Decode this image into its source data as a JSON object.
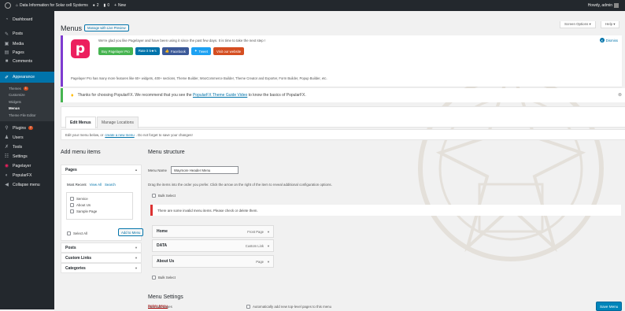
{
  "adminbar": {
    "site_name": "Data Information for Solar cell Systems",
    "comments_count": "2",
    "updates_count": "0",
    "new_label": "New",
    "howdy": "Howdy, admin"
  },
  "sidebar": {
    "items": [
      {
        "label": "Dashboard",
        "icon": "dashboard-icon"
      },
      {
        "label": "Posts",
        "icon": "pin-icon"
      },
      {
        "label": "Media",
        "icon": "media-icon"
      },
      {
        "label": "Pages",
        "icon": "page-icon"
      },
      {
        "label": "Comments",
        "icon": "comment-icon"
      },
      {
        "label": "Appearance",
        "icon": "brush-icon"
      }
    ],
    "appearance_sub": [
      "Themes",
      "Customize",
      "Widgets",
      "Menus",
      "Theme File Editor"
    ],
    "themes_badge": "1",
    "items_after": [
      {
        "label": "Plugins",
        "icon": "plugin-icon",
        "badge": "2"
      },
      {
        "label": "Users",
        "icon": "users-icon"
      },
      {
        "label": "Tools",
        "icon": "tools-icon"
      },
      {
        "label": "Settings",
        "icon": "settings-icon"
      },
      {
        "label": "PopularFX",
        "icon": "popularfx-icon"
      },
      {
        "label": "Pagelayer",
        "icon": "pagelayer-icon"
      }
    ],
    "collapse_label": "Collapse menu"
  },
  "header": {
    "title": "Menus",
    "manage_live": "Manage with Live Preview",
    "screen_options": "Screen Options ▾",
    "help": "Help ▾"
  },
  "pf_notice": {
    "text": "We're glad you like Pagelayer and have been using it since the past few days. It is time to take the next step !",
    "buttons": [
      "Buy Pagelayer Pro",
      "Rate it 5★'s",
      "Facebook",
      "Tweet",
      "Visit our website"
    ],
    "features": "Pagelayer Pro has many more features like 60+ widgets, 400+ sections, Theme Builder, WooCommerce Builder, Theme Creator and Exporter, Form Builder, Popup Builder, etc.",
    "dismiss": "Dismiss",
    "logo_letter": "p"
  },
  "thanks_notice": {
    "text_before": "Thanks for choosing PopularFX. We recommend that you see the ",
    "link": "PopularFX Theme Guide Video",
    "text_after": " to know the basics of PopularFX."
  },
  "tabs": [
    "Edit Menus",
    "Manage Locations"
  ],
  "edit_note": {
    "before": "Edit your menu below, or",
    "link": "create a new menu",
    "after": ". Do not forget to save your changes!"
  },
  "add_items": {
    "heading": "Add menu items",
    "pages_label": "Pages",
    "inner_tabs": [
      "Most Recent",
      "View All",
      "Search"
    ],
    "pages": [
      "Service",
      "About Us",
      "Sample Page"
    ],
    "select_all": "Select All",
    "add_button": "Add to Menu",
    "posts_label": "Posts",
    "custom_links_label": "Custom Links",
    "categories_label": "Categories"
  },
  "structure": {
    "heading": "Menu structure",
    "menu_name_label": "Menu Name",
    "menu_name_value": "Waymore Header Menu",
    "drag_text": "Drag the items into the order you prefer. Click the arrow on the right of the item to reveal additional configuration options.",
    "bulk_select": "Bulk Select",
    "invalid_notice": "There are some invalid menu items. Please check or delete them.",
    "items": [
      {
        "label": "Home",
        "type": "Front Page"
      },
      {
        "label": "DATA",
        "type": "Custom Link"
      },
      {
        "label": "About Us",
        "type": "Page"
      }
    ],
    "settings_heading": "Menu Settings",
    "auto_add_label": "Auto add pages",
    "auto_add_option": "Automatically add new top-level pages to this menu",
    "delete_menu": "Delete Menu",
    "save_button": "Save Menu"
  },
  "colors": {
    "admin_dark": "#23282d",
    "accent": "#0073aa",
    "pagelayer_pink": "#ec1f5e",
    "error_red": "#dc3232",
    "success_green": "#46b450"
  }
}
